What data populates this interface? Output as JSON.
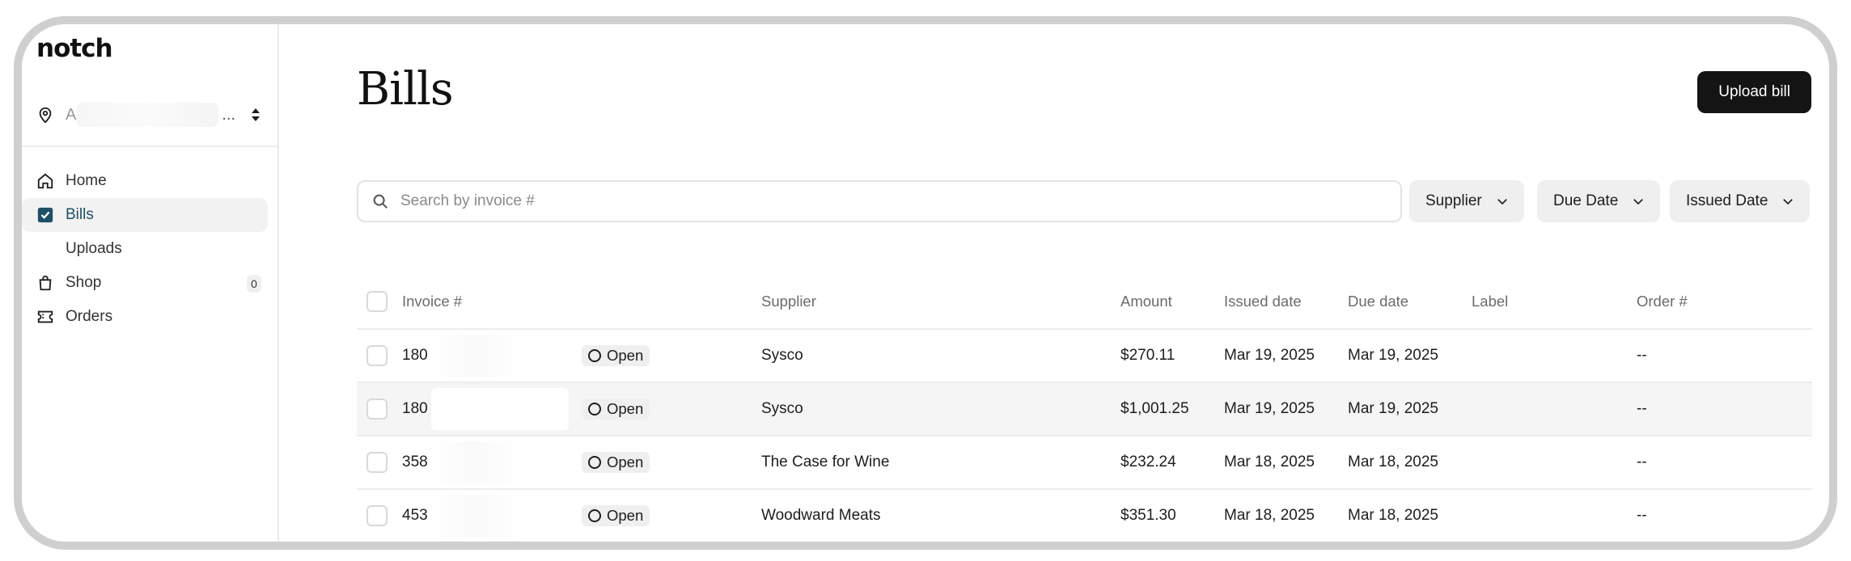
{
  "sidebar": {
    "logo": "notch",
    "location": {
      "name_visible": "A",
      "ellipsis": "..."
    },
    "items": [
      {
        "label": "Home"
      },
      {
        "label": "Bills"
      },
      {
        "label": "Uploads"
      },
      {
        "label": "Shop",
        "badge": "0"
      },
      {
        "label": "Orders"
      }
    ]
  },
  "header": {
    "title": "Bills",
    "upload_label": "Upload bill"
  },
  "search": {
    "placeholder": "Search by invoice #"
  },
  "filters": [
    "Supplier",
    "Due Date",
    "Issued Date"
  ],
  "table": {
    "columns": [
      "Invoice #",
      "Supplier",
      "Amount",
      "Issued date",
      "Due date",
      "Label",
      "Order #"
    ],
    "rows": [
      {
        "invoice": "180",
        "status": "Open",
        "supplier": "Sysco",
        "amount": "$270.11",
        "issued": "Mar 19, 2025",
        "due": "Mar 19, 2025",
        "label": "",
        "order": "--"
      },
      {
        "invoice": "180",
        "status": "Open",
        "supplier": "Sysco",
        "amount": "$1,001.25",
        "issued": "Mar 19, 2025",
        "due": "Mar 19, 2025",
        "label": "",
        "order": "--"
      },
      {
        "invoice": "358",
        "status": "Open",
        "supplier": "The Case for Wine",
        "amount": "$232.24",
        "issued": "Mar 18, 2025",
        "due": "Mar 18, 2025",
        "label": "",
        "order": "--"
      },
      {
        "invoice": "453",
        "status": "Open",
        "supplier": "Woodward Meats",
        "amount": "$351.30",
        "issued": "Mar 18, 2025",
        "due": "Mar 18, 2025",
        "label": "",
        "order": "--"
      }
    ]
  },
  "colors": {
    "active_nav": "#1f4f66",
    "button_bg": "#141414",
    "frame": "#cfcfcf"
  },
  "icons": [
    "location-pin-icon",
    "sort-icon",
    "home-icon",
    "bills-icon",
    "shop-icon",
    "orders-icon",
    "search-icon",
    "chevron-down-icon"
  ]
}
